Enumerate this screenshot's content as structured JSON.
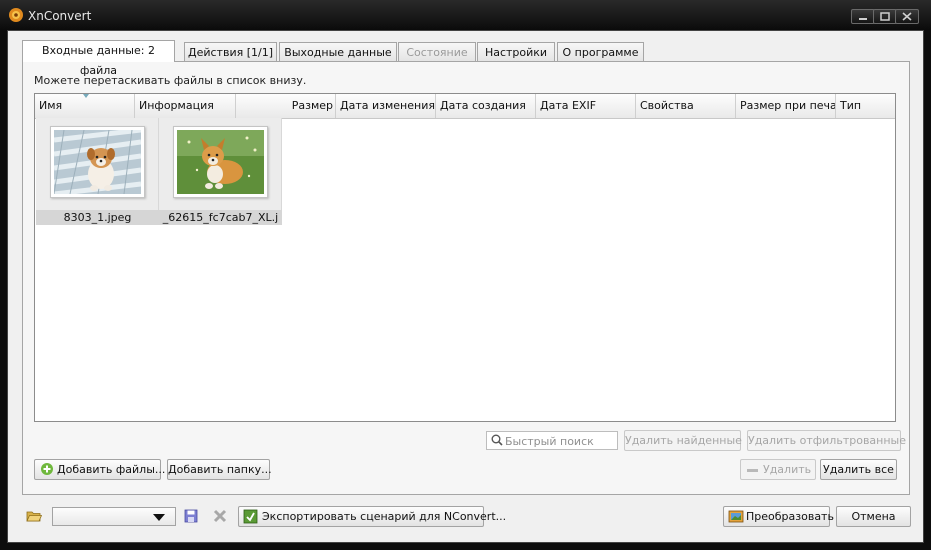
{
  "window": {
    "title": "XnConvert"
  },
  "tabs": [
    {
      "label": "Входные данные: 2 файла",
      "state": "active"
    },
    {
      "label": "Действия [1/1]",
      "state": "normal"
    },
    {
      "label": "Выходные данные",
      "state": "normal"
    },
    {
      "label": "Состояние",
      "state": "disabled"
    },
    {
      "label": "Настройки",
      "state": "normal"
    },
    {
      "label": "О программе",
      "state": "normal"
    }
  ],
  "input": {
    "hint": "Можете перетаскивать файлы в список внизу.",
    "columns": [
      "Имя",
      "Информация",
      "Размер",
      "Дата изменения",
      "Дата создания",
      "Дата EXIF",
      "Свойства",
      "Размер при печа",
      "Тип"
    ],
    "files": [
      {
        "name": "8303_1.jpeg",
        "thumbnail": "puppy-on-wooden-deck"
      },
      {
        "name": "_62615_fc7cab7_XL.j",
        "thumbnail": "puppy-on-grass"
      }
    ],
    "search_placeholder": "Быстрый поиск",
    "remove_found_label": "Удалить найденные",
    "remove_filtered_label": "Удалить отфильтрованные",
    "add_files_label": "Добавить файлы...",
    "add_folder_label": "Добавить папку...",
    "remove_label": "Удалить",
    "remove_all_label": "Удалить все"
  },
  "footer": {
    "preset_value": "",
    "export_label": "Экспортировать сценарий для NConvert...",
    "convert_label": "Преобразовать",
    "cancel_label": "Отмена"
  },
  "icons": {
    "app": "xnconvert-logo-icon",
    "minimize": "minimize-icon",
    "maximize": "maximize-icon",
    "close": "close-icon",
    "search": "search-icon",
    "add": "plus-icon",
    "remove": "minus-icon",
    "open_folder": "folder-open-icon",
    "save": "save-icon",
    "delete": "delete-icon",
    "export": "export-script-icon",
    "convert": "convert-icon",
    "dropdown": "chevron-down-icon"
  },
  "colors": {
    "titlebar": "#0d0d0d",
    "panel": "#f0f0f0",
    "thumbnail_caption": "#d6d6d6",
    "disabled_text": "#a6a6a6"
  }
}
